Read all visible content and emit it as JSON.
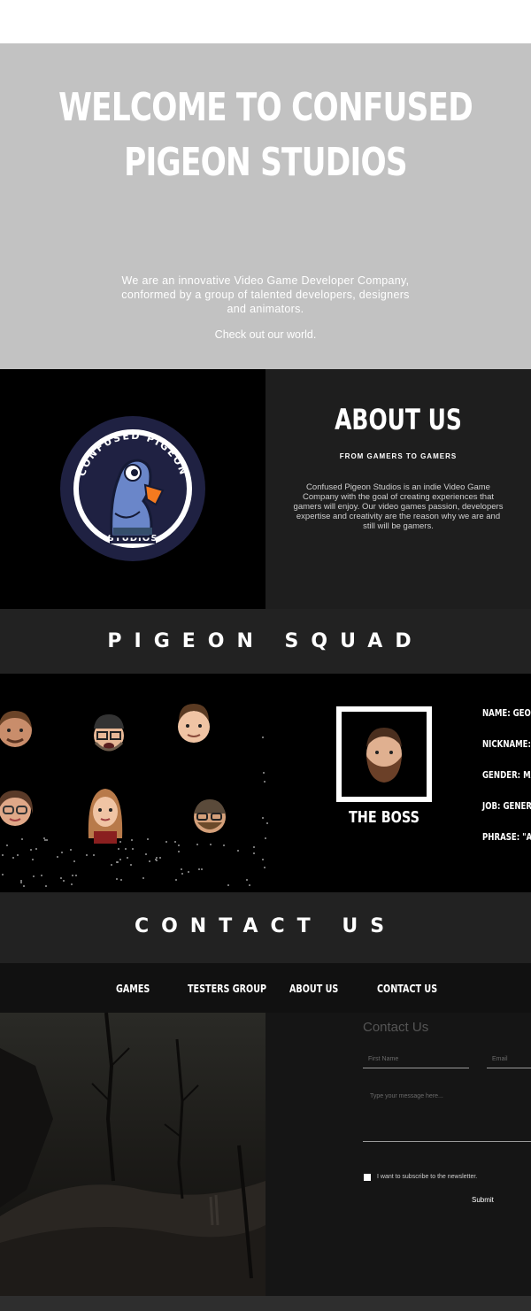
{
  "hero": {
    "title_line1": "WELCOME TO CONFUSED",
    "title_line2": "PIGEON STUDIOS",
    "description": "We are an innovative Video Game Developer Company, conformed  by a group of talented developers, designers  and  animators.",
    "cta": "Check out our world."
  },
  "about": {
    "logo_text_top": "CONFUSED PIGEON",
    "logo_text_bottom": "STUDIOS",
    "title": "ABOUT US",
    "subtitle": "FROM GAMERS TO GAMERS",
    "text": "Confused Pigeon Studios is an indie Video Game Company with the goal of creating experiences that gamers will enjoy. Our video games passion, developers expertise and creativity are the reason why we are and still will be gamers."
  },
  "squad": {
    "title": "PIGEON SQUAD",
    "boss_label": "THE BOSS",
    "info": [
      "NAME: GEOR",
      "NICKNAME: T",
      "GENDER: MA",
      "JOB: GENERA",
      "PHRASE: \"AL"
    ]
  },
  "contact": {
    "title": "CONTACT US"
  },
  "nav": {
    "items": [
      "GAMES",
      "TESTERS GROUP",
      "ABOUT US",
      "CONTACT US"
    ]
  },
  "form": {
    "title": "Contact Us",
    "first_name": "First Name",
    "email": "Email",
    "message": "Type your message here...",
    "newsletter": "I want to subscribe to the newsletter.",
    "submit": "Submit"
  },
  "colors": {
    "hero_bg": "#c2c2c2",
    "logo_ring": "#1f2142",
    "pigeon": "#6a86c9",
    "beak": "#f47a1f"
  }
}
